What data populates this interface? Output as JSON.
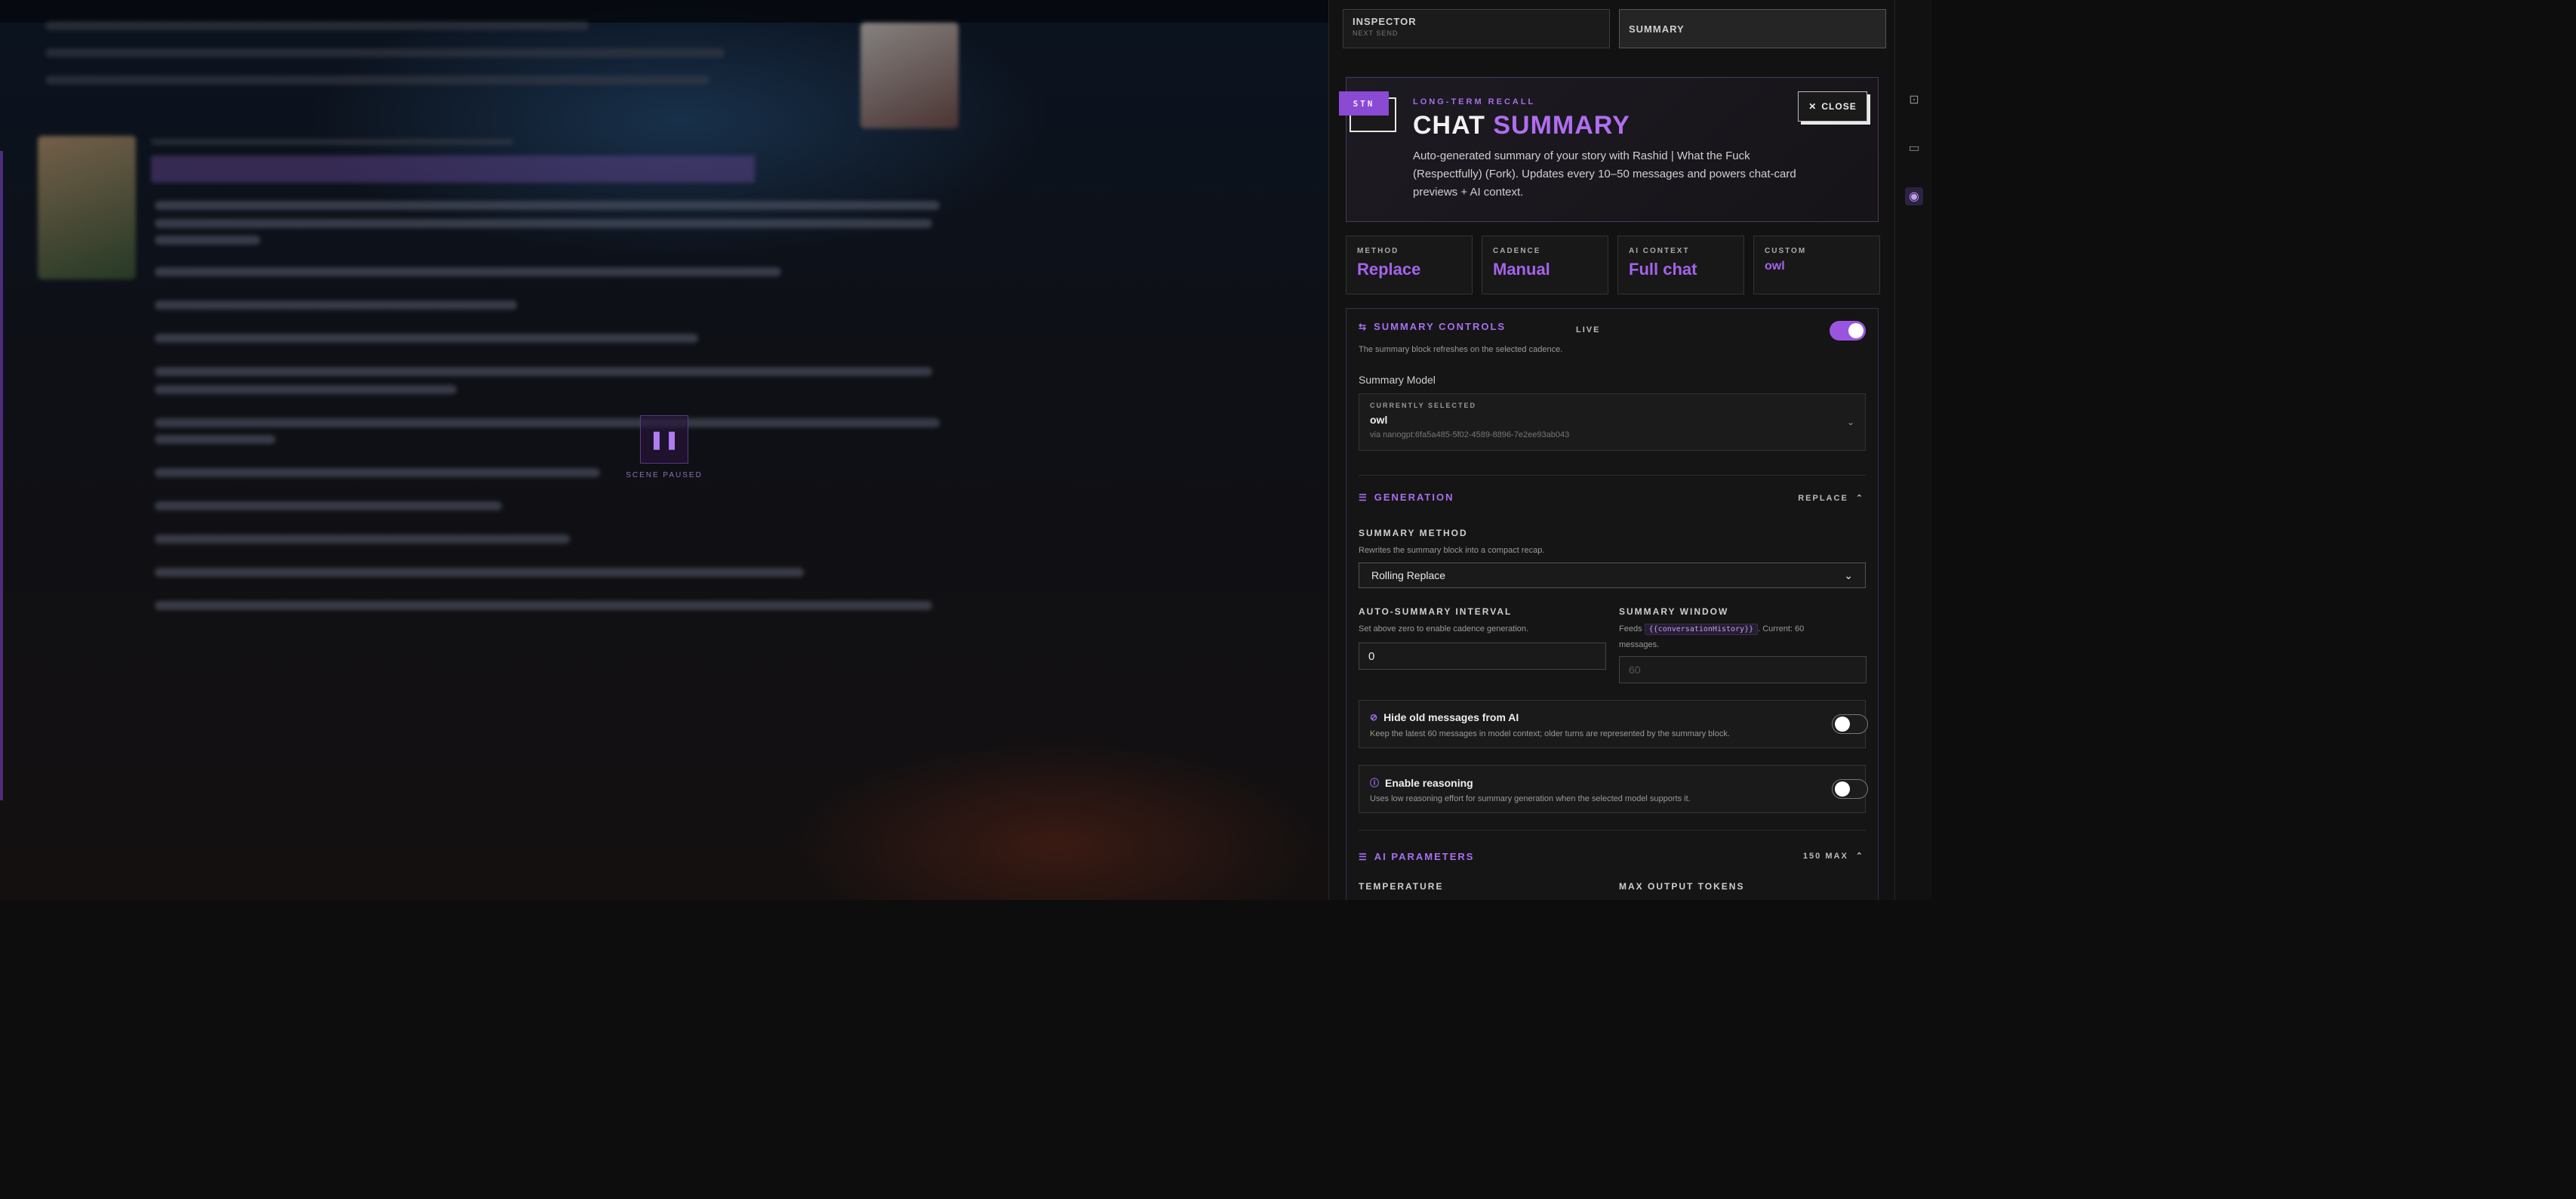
{
  "backdrop": {
    "pause_label": "SCENE PAUSED",
    "pause_icon": "pause-icon"
  },
  "tabs": [
    {
      "label": "INSPECTOR",
      "sub": "NEXT SEND"
    },
    {
      "label": "SUMMARY",
      "sub": ""
    }
  ],
  "rail": {
    "icons": [
      "frame-icon",
      "monitor-icon",
      "eye-icon"
    ]
  },
  "hero": {
    "badge": "STN",
    "eyebrow": "LONG-TERM RECALL",
    "title_main": "CHAT",
    "title_accent": "SUMMARY",
    "description": "Auto-generated summary of your story with Rashid | What the Fuck (Respectfully) (Fork). Updates every 10–50 messages and powers chat-card previews + AI context.",
    "close_label": "CLOSE"
  },
  "stats": [
    {
      "label": "METHOD",
      "value": "Replace"
    },
    {
      "label": "CADENCE",
      "value": "Manual"
    },
    {
      "label": "AI CONTEXT",
      "value": "Full chat"
    },
    {
      "label": "CUSTOM",
      "value": "owl"
    }
  ],
  "summary_controls": {
    "title": "SUMMARY CONTROLS",
    "live": "LIVE",
    "enabled": true,
    "note": "The summary block refreshes on the selected cadence.",
    "model_label": "Summary Model",
    "model_caption": "CURRENTLY SELECTED",
    "model_name": "owl",
    "model_via": "via nanogpt:6fa5a485-5f02-4589-8896-7e2ee93ab043"
  },
  "generation": {
    "title": "GENERATION",
    "right_label": "REPLACE",
    "method_label": "SUMMARY METHOD",
    "method_note": "Rewrites the summary block into a compact recap.",
    "method_value": "Rolling Replace",
    "interval_label": "AUTO-SUMMARY INTERVAL",
    "interval_note": "Set above zero to enable cadence generation.",
    "interval_value": "0",
    "window_label": "SUMMARY WINDOW",
    "window_note_pre": "Feeds",
    "window_chip": "{{conversationHistory}}",
    "window_note_post": ". Current: 60",
    "window_note_tail": "messages.",
    "window_placeholder": "60",
    "hide_title": "Hide old messages from AI",
    "hide_desc": "Keep the latest 60 messages in model context; older turns are represented by the summary block.",
    "hide_enabled": false,
    "reason_title": "Enable reasoning",
    "reason_desc": "Uses low reasoning effort for summary generation when the selected model supports it.",
    "reason_enabled": false
  },
  "ai_parameters": {
    "title": "AI PARAMETERS",
    "right_label": "150 MAX",
    "temperature_label": "TEMPERATURE",
    "max_tokens_label": "MAX OUTPUT TOKENS"
  },
  "colors": {
    "accent": "#a86ff0",
    "badge": "#8a4ad4",
    "panel_bg": "#121212"
  }
}
